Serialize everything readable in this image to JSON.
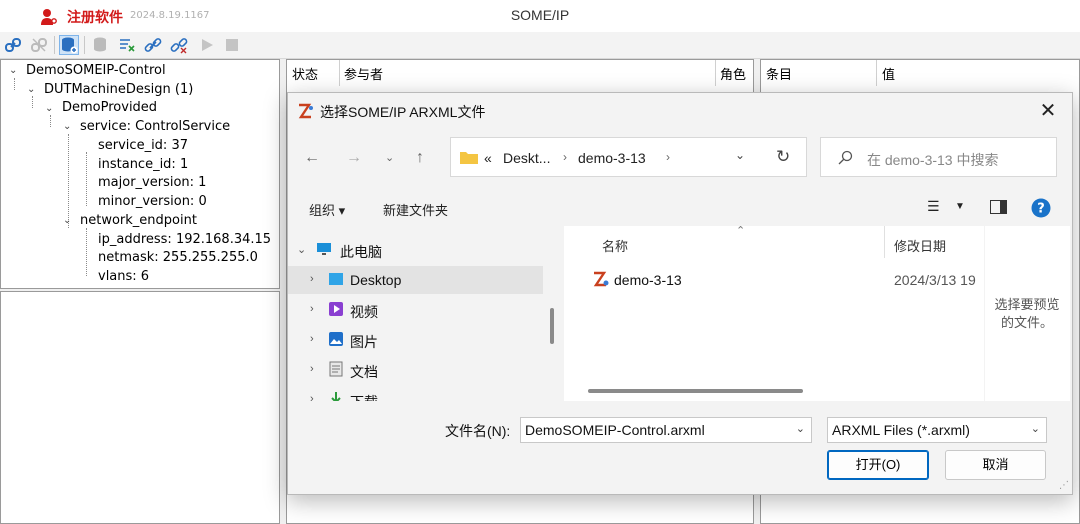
{
  "app": {
    "register_label": "注册软件",
    "version": "2024.8.19.1167",
    "title": "SOME/IP",
    "colors": {
      "register": "#d21a1a",
      "accent": "#0067c0"
    }
  },
  "toolbar": {
    "icons": [
      "link-icon",
      "unlink-icon",
      "database-add-icon",
      "database-remove-icon",
      "clear-list-icon",
      "chain-icon",
      "chain-break-icon",
      "play-icon",
      "stop-icon"
    ]
  },
  "tree": {
    "root": "DemoSOMEIP-Control",
    "machine": "DUTMachineDesign (1)",
    "provided": "DemoProvided",
    "service": "service: ControlService",
    "service_id": "service_id: 37",
    "instance_id": "instance_id: 1",
    "major_version": "major_version: 1",
    "minor_version": "minor_version: 0",
    "network_endpoint": "network_endpoint",
    "ip_address": "ip_address: 192.168.34.15",
    "netmask": "netmask: 255.255.255.0",
    "vlans": "vlans: 6"
  },
  "middle_table": {
    "col_status": "状态",
    "col_participant": "参与者",
    "col_role": "角色"
  },
  "right_table": {
    "col_item": "条目",
    "col_value": "值"
  },
  "dialog": {
    "title": "选择SOME/IP ARXML文件",
    "address": {
      "overflow": "«",
      "seg1": "Deskt...",
      "seg2": "demo-3-13"
    },
    "search_placeholder": "在 demo-3-13 中搜索",
    "organize": "组织 ▾",
    "new_folder": "新建文件夹",
    "nav": [
      {
        "label": "此电脑"
      },
      {
        "label": "Desktop"
      },
      {
        "label": "视频"
      },
      {
        "label": "图片"
      },
      {
        "label": "文档"
      },
      {
        "label": "下载"
      }
    ],
    "col_name": "名称",
    "col_modified": "修改日期",
    "file": {
      "name": "demo-3-13",
      "modified": "2024/3/13 19"
    },
    "preview_text": "选择要预览的文件。",
    "filename_label": "文件名(N):",
    "filename_value": "DemoSOMEIP-Control.arxml",
    "filetype_value": "ARXML Files (*.arxml)",
    "open_button": "打开(O)",
    "cancel_button": "取消"
  }
}
